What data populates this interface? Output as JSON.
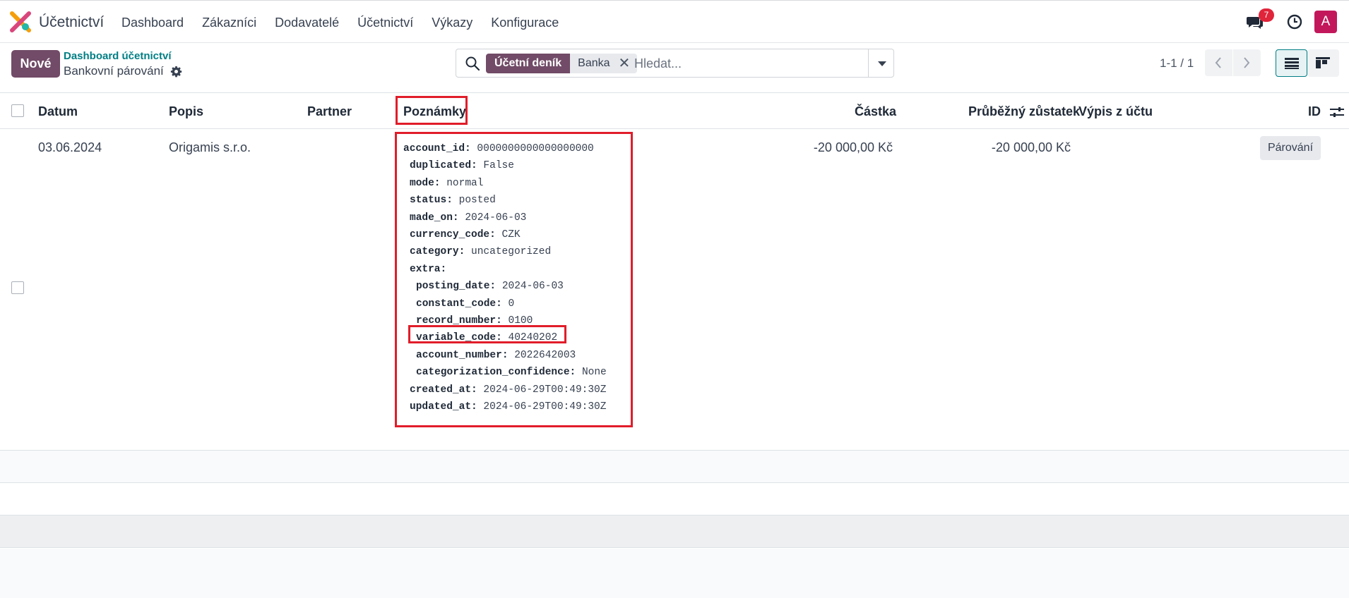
{
  "app": {
    "name": "Účetnictví"
  },
  "menu": [
    "Dashboard",
    "Zákazníci",
    "Dodavatelé",
    "Účetnictví",
    "Výkazy",
    "Konfigurace"
  ],
  "systray": {
    "chat_count": "7",
    "avatar_letter": "A"
  },
  "control": {
    "new_label": "Nové",
    "breadcrumb_parent": "Dashboard účetnictví",
    "breadcrumb_current": "Bankovní párování"
  },
  "search": {
    "facet_label": "Účetní deník",
    "facet_value": "Banka",
    "placeholder": "Hledat..."
  },
  "pager": {
    "value": "1-1 / 1"
  },
  "table": {
    "columns": [
      "Datum",
      "Popis",
      "Partner",
      "Poznámky",
      "Částka",
      "Průběžný zůstatek",
      "Výpis z účtu",
      "ID"
    ],
    "row": {
      "date": "03.06.2024",
      "description": "Origamis s.r.o.",
      "partner": "",
      "amount": "-20 000,00 Kč",
      "running_balance": "-20 000,00 Kč",
      "statement": "",
      "match_button": "Párování"
    },
    "notes": {
      "account_id_k": "account_id:",
      "account_id_v": "0000000000000000000",
      "duplicated_k": "duplicated:",
      "duplicated_v": "False",
      "mode_k": "mode:",
      "mode_v": "normal",
      "status_k": "status:",
      "status_v": "posted",
      "made_on_k": "made_on:",
      "made_on_v": "2024-06-03",
      "currency_code_k": "currency_code:",
      "currency_code_v": "CZK",
      "category_k": "category:",
      "category_v": "uncategorized",
      "extra_k": "extra:",
      "posting_date_k": "posting_date:",
      "posting_date_v": "2024-06-03",
      "constant_code_k": "constant_code:",
      "constant_code_v": "0",
      "record_number_k": "record_number:",
      "record_number_v": "0100",
      "variable_code_k": "variable_code:",
      "variable_code_v": "40240202",
      "account_number_k": "account_number:",
      "account_number_v": "2022642003",
      "categorization_confidence_k": "categorization_confidence:",
      "categorization_confidence_v": "None",
      "created_at_k": "created_at:",
      "created_at_v": "2024-06-29T00:49:30Z",
      "updated_at_k": "updated_at:",
      "updated_at_v": "2024-06-29T00:49:30Z"
    }
  },
  "colors": {
    "brand": "#714b67",
    "highlight": "#e11d2a",
    "link": "#017e84"
  }
}
